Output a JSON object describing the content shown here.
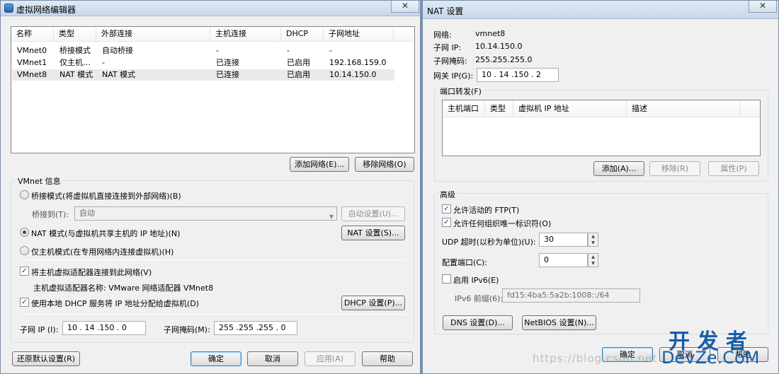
{
  "left_window": {
    "title": "虚拟网络编辑器",
    "close": "✕",
    "table": {
      "headers": [
        "名称",
        "类型",
        "外部连接",
        "主机连接",
        "DHCP",
        "子网地址"
      ],
      "rows": [
        [
          "VMnet0",
          "桥接模式",
          "自动桥接",
          "-",
          "-",
          "-"
        ],
        [
          "VMnet1",
          "仅主机…",
          "-",
          "已连接",
          "已启用",
          "192.168.159.0"
        ],
        [
          "VMnet8",
          "NAT 模式",
          "NAT 模式",
          "已连接",
          "已启用",
          "10.14.150.0"
        ]
      ]
    },
    "add_network": "添加网络(E)...",
    "remove_network": "移除网络(O)",
    "vmnet_info_label": "VMnet 信息",
    "bridge_mode": "桥接模式(将虚拟机直接连接到外部网络)(B)",
    "bridge_to_label": "桥接到(T):",
    "bridge_to_value": "自动",
    "auto_settings": "自动设置(U)...",
    "nat_mode": "NAT 模式(与虚拟机共享主机的 IP 地址)(N)",
    "nat_settings": "NAT 设置(S)...",
    "host_only_mode": "仅主机模式(在专用网络内连接虚拟机)(H)",
    "connect_adapter": "将主机虚拟适配器连接到此网络(V)",
    "adapter_name": "主机虚拟适配器名称: VMware 网络适配器 VMnet8",
    "use_dhcp": "使用本地 DHCP 服务将 IP 地址分配给虚拟机(D)",
    "dhcp_settings": "DHCP 设置(P)...",
    "subnet_ip_label": "子网 IP (I):",
    "subnet_ip_value": "10 . 14 .150 . 0",
    "subnet_mask_label": "子网掩码(M):",
    "subnet_mask_value": "255 .255 .255 . 0",
    "restore_defaults": "还原默认设置(R)",
    "ok": "确定",
    "cancel": "取消",
    "apply": "应用(A)",
    "help": "帮助"
  },
  "right_window": {
    "title": "NAT 设置",
    "close": "✕",
    "network_label": "网络:",
    "network_value": "vmnet8",
    "subnet_ip_label": "子网 IP:",
    "subnet_ip_value": "10.14.150.0",
    "subnet_mask_label": "子网掩码:",
    "subnet_mask_value": "255.255.255.0",
    "gateway_label": "网关 IP(G):",
    "gateway_value": "10 . 14 .150 . 2",
    "port_forward_label": "端口转发(F)",
    "pf_headers": [
      "主机端口",
      "类型",
      "虚拟机 IP 地址",
      "描述"
    ],
    "add": "添加(A)...",
    "remove": "移除(R)",
    "properties": "属性(P)",
    "advanced_label": "高级",
    "allow_ftp": "允许活动的 FTP(T)",
    "allow_oui": "允许任何组织唯一标识符(O)",
    "udp_timeout_label": "UDP 超时(以秒为单位)(U):",
    "udp_timeout_value": "30",
    "config_port_label": "配置端口(C):",
    "config_port_value": "0",
    "enable_ipv6": "启用 IPv6(E)",
    "ipv6_prefix_label": "IPv6 前缀(6):",
    "ipv6_prefix_value": "fd15:4ba5:5a2b:1008::/64",
    "dns_settings": "DNS 设置(D)...",
    "netbios_settings": "NetBIOS 设置(N)...",
    "ok": "确定",
    "cancel": "取消",
    "help": "帮助"
  },
  "watermark": {
    "url": "https://blog.csdn.net",
    "logo_top": "开 发 者",
    "logo_bottom": "DevZe.CoM"
  }
}
